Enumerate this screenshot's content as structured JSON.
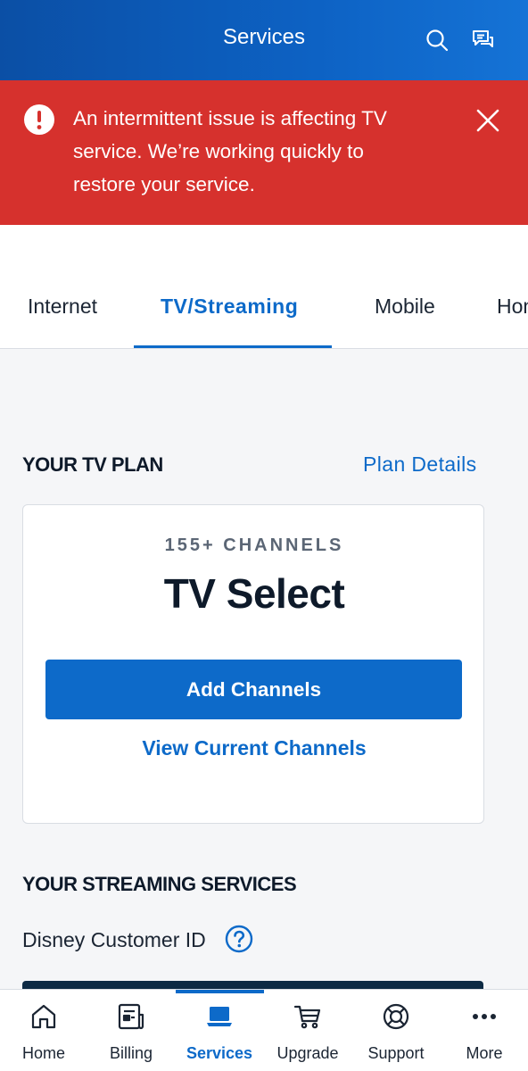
{
  "header": {
    "title": "Services",
    "search_icon": "search-icon",
    "chat_icon": "chat-icon"
  },
  "alert": {
    "icon": "alert-icon",
    "lines": [
      "An intermittent issue is affecting TV",
      "service. We’re working quickly to",
      "restore your service."
    ],
    "close_icon": "close-icon",
    "color": "#d6312d"
  },
  "tabs": [
    {
      "label": "Internet",
      "active": false
    },
    {
      "label": "TV/Streaming",
      "active": true
    },
    {
      "label": "Mobile",
      "active": false
    },
    {
      "label": "Home",
      "active": false
    }
  ],
  "tv_plan": {
    "section_title": "YOUR TV PLAN",
    "details_link": "Plan Details",
    "channels": "155+ CHANNELS",
    "plan_name": "TV Select",
    "add_button": "Add Channels",
    "view_link": "View Current Channels"
  },
  "streaming": {
    "section_title": "YOUR STREAMING SERVICES",
    "disney_label": "Disney Customer ID",
    "help_icon": "help-icon"
  },
  "bottom_nav": [
    {
      "label": "Home",
      "icon": "home-icon",
      "active": false
    },
    {
      "label": "Billing",
      "icon": "billing-icon",
      "active": false
    },
    {
      "label": "Services",
      "icon": "services-icon",
      "active": true
    },
    {
      "label": "Upgrade",
      "icon": "cart-icon",
      "active": false
    },
    {
      "label": "Support",
      "icon": "lifebuoy-icon",
      "active": false
    },
    {
      "label": "More",
      "icon": "more-icon",
      "active": false
    }
  ],
  "colors": {
    "brand_blue": "#0d6ac9",
    "header_blue": "#0b4fa5",
    "alert_red": "#d6312d",
    "text_dark": "#0e1a2a"
  }
}
